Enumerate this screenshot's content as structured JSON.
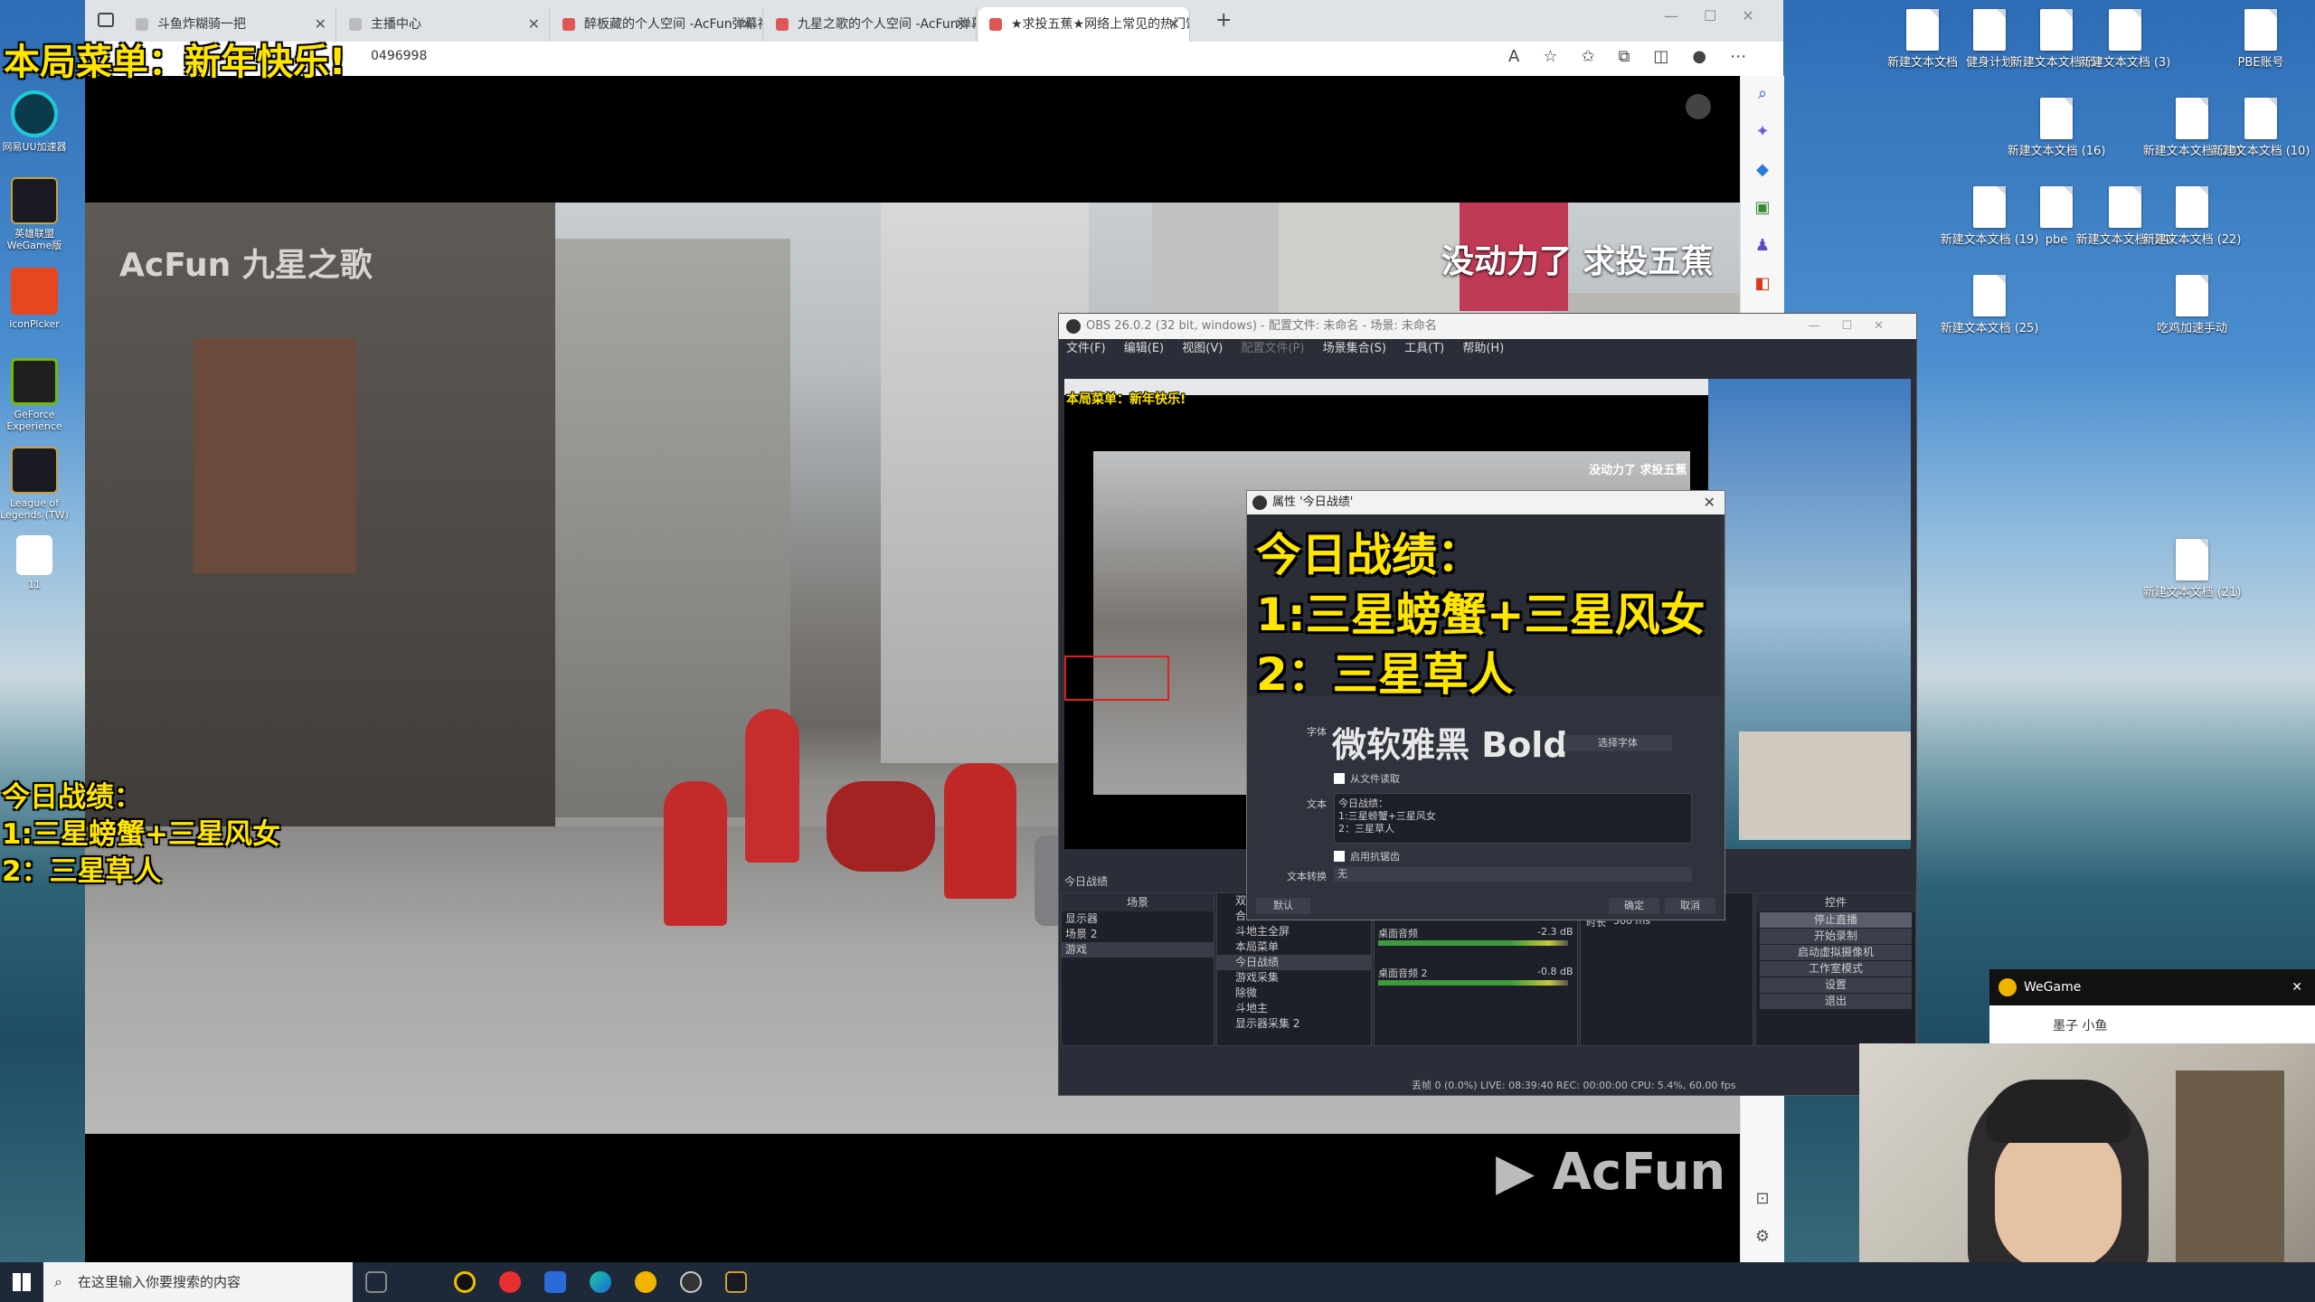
{
  "desktop": {
    "right_icons": [
      {
        "label": "新建文本文档"
      },
      {
        "label": "健身计划"
      },
      {
        "label": "新建文本文档 (5)"
      },
      {
        "label": "新建文本文档 (3)"
      },
      {
        "label": "PBE账号"
      },
      {
        "label": "新建文本文档 (16)"
      },
      {
        "label": "新建文本文档 (20)"
      },
      {
        "label": "新建文本文档 (10)"
      },
      {
        "label": "新建文本文档 (19)"
      },
      {
        "label": "pbe"
      },
      {
        "label": "新建文本文档 (24)"
      },
      {
        "label": "新建文本文档 (22)"
      },
      {
        "label": "新建文本文档 (25)"
      },
      {
        "label": "吃鸡加速手动"
      },
      {
        "label": "新建文本文档 (21)"
      }
    ],
    "left_icons": [
      {
        "label": "网易UU加速器"
      },
      {
        "label": "英雄联盟WeGame版"
      },
      {
        "label": "iconPicker"
      },
      {
        "label": "GeForce Experience"
      },
      {
        "label": "League of Legends (TW)"
      },
      {
        "label": "11"
      }
    ]
  },
  "browser": {
    "tabs": [
      {
        "label": "斗鱼炸糊骑一把"
      },
      {
        "label": "主播中心"
      },
      {
        "label": "醉板藏的个人空间 -AcFun弹幕视"
      },
      {
        "label": "九星之歌的个人空间 -AcFun弹幕"
      },
      {
        "label": "★求投五蕉★网络上常见的热门饭"
      }
    ],
    "new_tab": "+",
    "address": "0496998",
    "video": {
      "watermark_left": "AcFun 九星之歌",
      "subtitle_right": "没动力了 求投五蕉",
      "bottom_logo": "AcFun"
    }
  },
  "overlay": {
    "top_banner": "本局菜单：新年快乐!",
    "stats": "今日战绩：\n1:三星螃蟹+三星风女\n2：三星草人"
  },
  "obs": {
    "title": "OBS 26.0.2 (32 bit, windows) - 配置文件: 未命名 - 场景: 未命名",
    "menu": [
      "文件(F)",
      "编辑(E)",
      "视图(V)",
      "配置文件(P)",
      "场景集合(S)",
      "工具(T)",
      "帮助(H)"
    ],
    "mini_banner": "本局菜单：新年快乐!",
    "mini_subtitle": "没动力了 求投五蕉",
    "properties": {
      "title": "属性 '今日战绩'",
      "preview_text": "今日战绩：\n1:三星螃蟹+三星风女\n2：三星草人",
      "font_label": "字体",
      "font_value": "微软雅黑 Bold",
      "font_button": "选择字体",
      "from_file": "从文件读取",
      "text_label": "文本",
      "text_value": "今日战绩：\n1:三星螃蟹+三星风女\n2：三星草人",
      "antialias": "启用抗锯齿",
      "transform_label": "文本转换",
      "transform_value": "无",
      "default_btn": "默认",
      "ok_btn": "确定",
      "cancel_btn": "取消"
    },
    "current_source": "今日战绩",
    "scenes_head": "场景",
    "scenes": [
      "显示器",
      "场景 2",
      "游戏"
    ],
    "sources": [
      "双",
      "合作",
      "斗地主全屏",
      "本局菜单",
      "今日战绩",
      "游戏采集",
      "除微",
      "斗地主",
      "显示器采集 2"
    ],
    "mixer": [
      {
        "name": "",
        "db": ""
      },
      {
        "name": "桌面音频",
        "db": "-2.3 dB"
      },
      {
        "name": "桌面音频 2",
        "db": "-0.8 dB"
      }
    ],
    "transition_label": "时长",
    "transition_value": "300 ms",
    "controls_head": "控件",
    "controls": [
      "停止直播",
      "开始录制",
      "启动虚拟摄像机",
      "工作室模式",
      "设置",
      "退出"
    ],
    "status": "丢帧 0 (0.0%)   LIVE: 08:39:40   REC: 00:00:00   CPU: 5.4%, 60.00 fps"
  },
  "wegame": {
    "title": "WeGame",
    "close": "✕",
    "user": "墨子 小鱼"
  },
  "taskbar": {
    "search_placeholder": "在这里输入你要搜索的内容"
  },
  "colors": {
    "overlay_yellow": "#ffe600",
    "obs_bg": "#2b2e38",
    "taskbar": "#1d2838"
  }
}
